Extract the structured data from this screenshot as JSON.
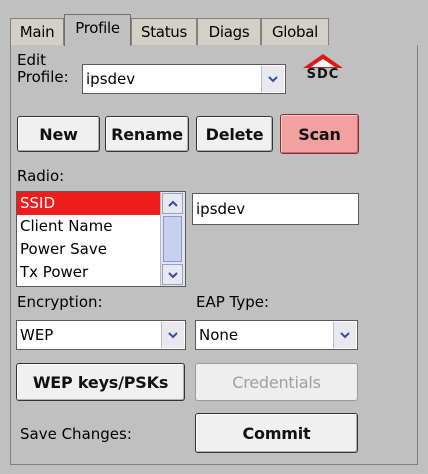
{
  "tabs": [
    {
      "label": "Main"
    },
    {
      "label": "Profile"
    },
    {
      "label": "Status"
    },
    {
      "label": "Diags"
    },
    {
      "label": "Global"
    }
  ],
  "edit_profile": {
    "label_line1": "Edit",
    "label_line2": "Profile:",
    "value": "ipsdev"
  },
  "logo": {
    "text": "SDC",
    "color": "#e01818"
  },
  "buttons": {
    "new": "New",
    "rename": "Rename",
    "delete": "Delete",
    "scan": "Scan"
  },
  "radio": {
    "label": "Radio:",
    "items": [
      "SSID",
      "Client Name",
      "Power Save",
      "Tx Power"
    ],
    "selected_index": 0,
    "value": "ipsdev"
  },
  "encryption": {
    "label": "Encryption:",
    "value": "WEP"
  },
  "eap": {
    "label": "EAP Type:",
    "value": "None"
  },
  "wep_keys_button": "WEP keys/PSKs",
  "credentials_button": "Credentials",
  "save_changes_label": "Save Changes:",
  "commit_button": "Commit",
  "colors": {
    "selection": "#ee1c1c",
    "scan_button": "#f2a0a0",
    "panel": "#c0c0c0"
  }
}
